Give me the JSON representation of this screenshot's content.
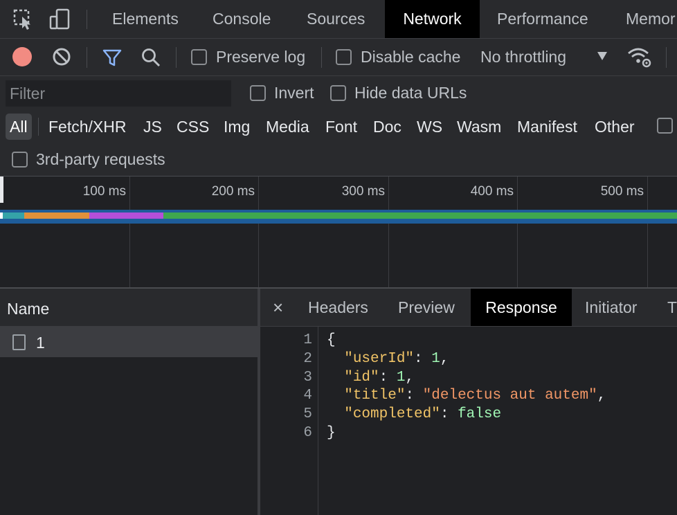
{
  "tabs": [
    "Elements",
    "Console",
    "Sources",
    "Network",
    "Performance",
    "Memor"
  ],
  "active_tab": "Network",
  "toolbar": {
    "preserve_log": "Preserve log",
    "disable_cache": "Disable cache",
    "throttling": "No throttling"
  },
  "filter": {
    "placeholder": "Filter",
    "invert": "Invert",
    "hide_data_urls": "Hide data URLs"
  },
  "types": [
    "All",
    "Fetch/XHR",
    "JS",
    "CSS",
    "Img",
    "Media",
    "Font",
    "Doc",
    "WS",
    "Wasm",
    "Manifest",
    "Other"
  ],
  "third_party": "3rd-party requests",
  "timeline": {
    "ticks": [
      "100 ms",
      "200 ms",
      "300 ms",
      "400 ms",
      "500 ms"
    ],
    "colors": {
      "stalled": "#35a3a8",
      "connect": "#e0913a",
      "ssl": "#b44fd9",
      "waiting": "#3fa74e",
      "track": "#1e5c99"
    }
  },
  "requests": {
    "name_header": "Name",
    "rows": [
      {
        "name": "1"
      }
    ]
  },
  "detail_tabs": [
    "Headers",
    "Preview",
    "Response",
    "Initiator",
    "T"
  ],
  "active_detail_tab": "Response",
  "close_glyph": "×",
  "response": {
    "line_numbers": [
      "1",
      "2",
      "3",
      "4",
      "5",
      "6"
    ],
    "open_brace": "{",
    "close_brace": "}",
    "fields": [
      {
        "key": "\"userId\"",
        "value": "1",
        "type": "number"
      },
      {
        "key": "\"id\"",
        "value": "1",
        "type": "number"
      },
      {
        "key": "\"title\"",
        "value": "\"delectus aut autem\"",
        "type": "string"
      },
      {
        "key": "\"completed\"",
        "value": "false",
        "type": "boolean"
      }
    ]
  }
}
